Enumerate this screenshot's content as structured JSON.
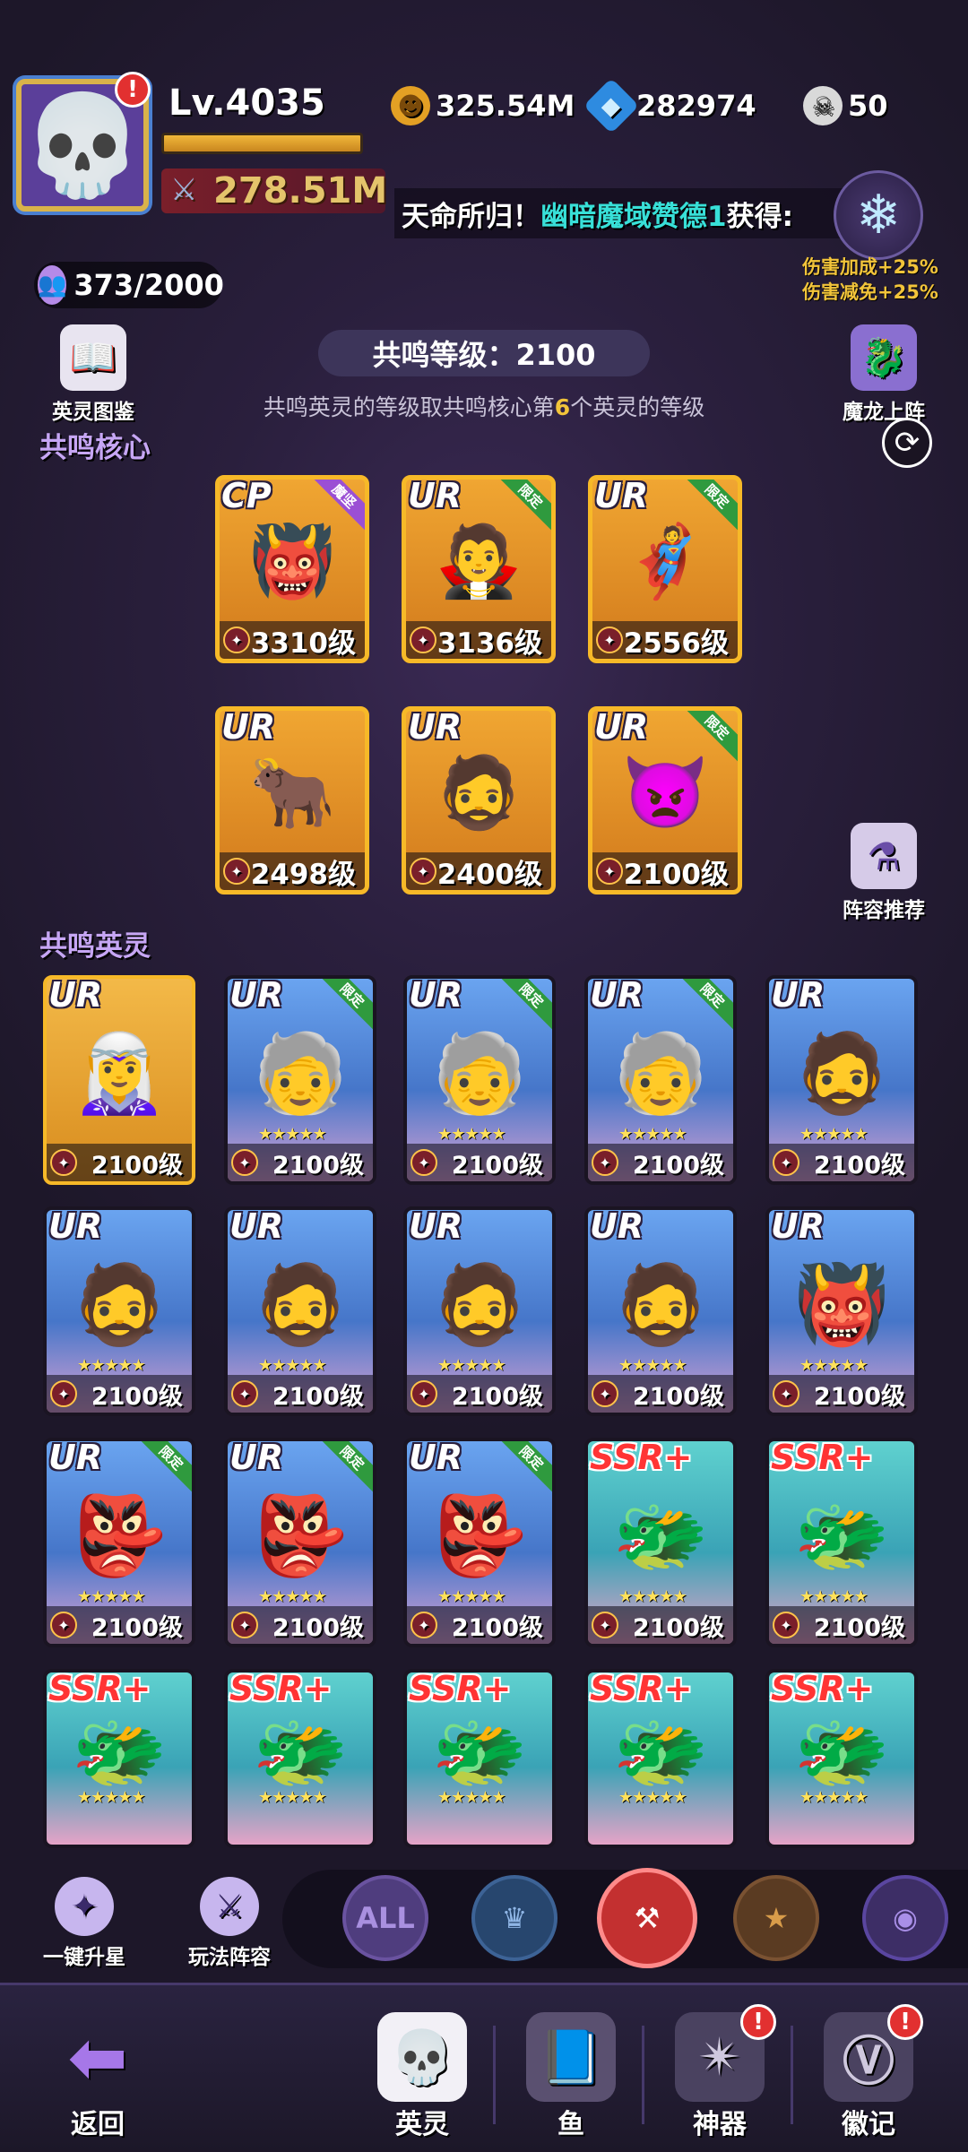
{
  "player": {
    "level": "Lv.4035",
    "power": "278.51M",
    "avatar_icon": "skull-icon",
    "badge": "!"
  },
  "resources": {
    "gold": "325.54M",
    "diamonds": "282974",
    "skulls": "50"
  },
  "banner": {
    "prefix": "天命所归！",
    "name": "幽暗魔域赞德1",
    "suffix": "获得:",
    "bonus1": "伤害加成+25%",
    "bonus2": "伤害减免+25%"
  },
  "roster_count": "373/2000",
  "left_buttons": {
    "codex": "英灵图鉴"
  },
  "right_buttons": {
    "dragon": "魔龙上阵",
    "lineup": "阵容推荐"
  },
  "resonance": {
    "level_text": "共鸣等级：2100",
    "hint_pre": "共鸣英灵的等级取共鸣核心第",
    "hint_num": "6",
    "hint_post": "个英灵的等级"
  },
  "sections": {
    "core": "共鸣核心",
    "heroes": "共鸣英灵"
  },
  "core_heroes": [
    {
      "rank": "CP",
      "tag": "魔坚",
      "level": "3310级"
    },
    {
      "rank": "UR",
      "tag": "限定",
      "level": "3136级"
    },
    {
      "rank": "UR",
      "tag": "限定",
      "level": "2556级"
    },
    {
      "rank": "UR",
      "tag": "",
      "level": "2498级"
    },
    {
      "rank": "UR",
      "tag": "",
      "level": "2400级"
    },
    {
      "rank": "UR",
      "tag": "限定",
      "level": "2100级"
    }
  ],
  "heroes": [
    {
      "rank": "UR",
      "tag": "",
      "level": "2100级",
      "stars": ""
    },
    {
      "rank": "UR",
      "tag": "限定",
      "level": "2100级",
      "stars": "★★★★★"
    },
    {
      "rank": "UR",
      "tag": "限定",
      "level": "2100级",
      "stars": "★★★★★"
    },
    {
      "rank": "UR",
      "tag": "限定",
      "level": "2100级",
      "stars": "★★★★★"
    },
    {
      "rank": "UR",
      "tag": "",
      "level": "2100级",
      "stars": "★★★★★"
    },
    {
      "rank": "UR",
      "tag": "",
      "level": "2100级",
      "stars": "★★★★★"
    },
    {
      "rank": "UR",
      "tag": "",
      "level": "2100级",
      "stars": "★★★★★"
    },
    {
      "rank": "UR",
      "tag": "",
      "level": "2100级",
      "stars": "★★★★★"
    },
    {
      "rank": "UR",
      "tag": "",
      "level": "2100级",
      "stars": "★★★★★"
    },
    {
      "rank": "UR",
      "tag": "",
      "level": "2100级",
      "stars": "★★★★★"
    },
    {
      "rank": "UR",
      "tag": "限定",
      "level": "2100级",
      "stars": "★★★★★"
    },
    {
      "rank": "UR",
      "tag": "限定",
      "level": "2100级",
      "stars": "★★★★★"
    },
    {
      "rank": "UR",
      "tag": "限定",
      "level": "2100级",
      "stars": "★★★★★"
    },
    {
      "rank": "SSR+",
      "tag": "",
      "level": "2100级",
      "stars": "★★★★★"
    },
    {
      "rank": "SSR+",
      "tag": "",
      "level": "2100级",
      "stars": "★★★★★"
    },
    {
      "rank": "SSR+",
      "tag": "",
      "level": "",
      "stars": "★★★★★"
    },
    {
      "rank": "SSR+",
      "tag": "",
      "level": "",
      "stars": "★★★★★"
    },
    {
      "rank": "SSR+",
      "tag": "",
      "level": "",
      "stars": "★★★★★"
    },
    {
      "rank": "SSR+",
      "tag": "",
      "level": "",
      "stars": "★★★★★"
    },
    {
      "rank": "SSR+",
      "tag": "",
      "level": "",
      "stars": "★★★★★"
    }
  ],
  "actions": {
    "star_up": "一键升星",
    "lineups": "玩法阵容"
  },
  "filters": {
    "all": "ALL"
  },
  "nav": {
    "back": "返回",
    "heroes": "英灵",
    "fish": "鱼",
    "artifact": "神器",
    "emblem": "徽记"
  },
  "colors": {
    "accent_gold": "#f2c43a",
    "highlight_cyan": "#38e0d8",
    "alert_red": "#e23030"
  }
}
